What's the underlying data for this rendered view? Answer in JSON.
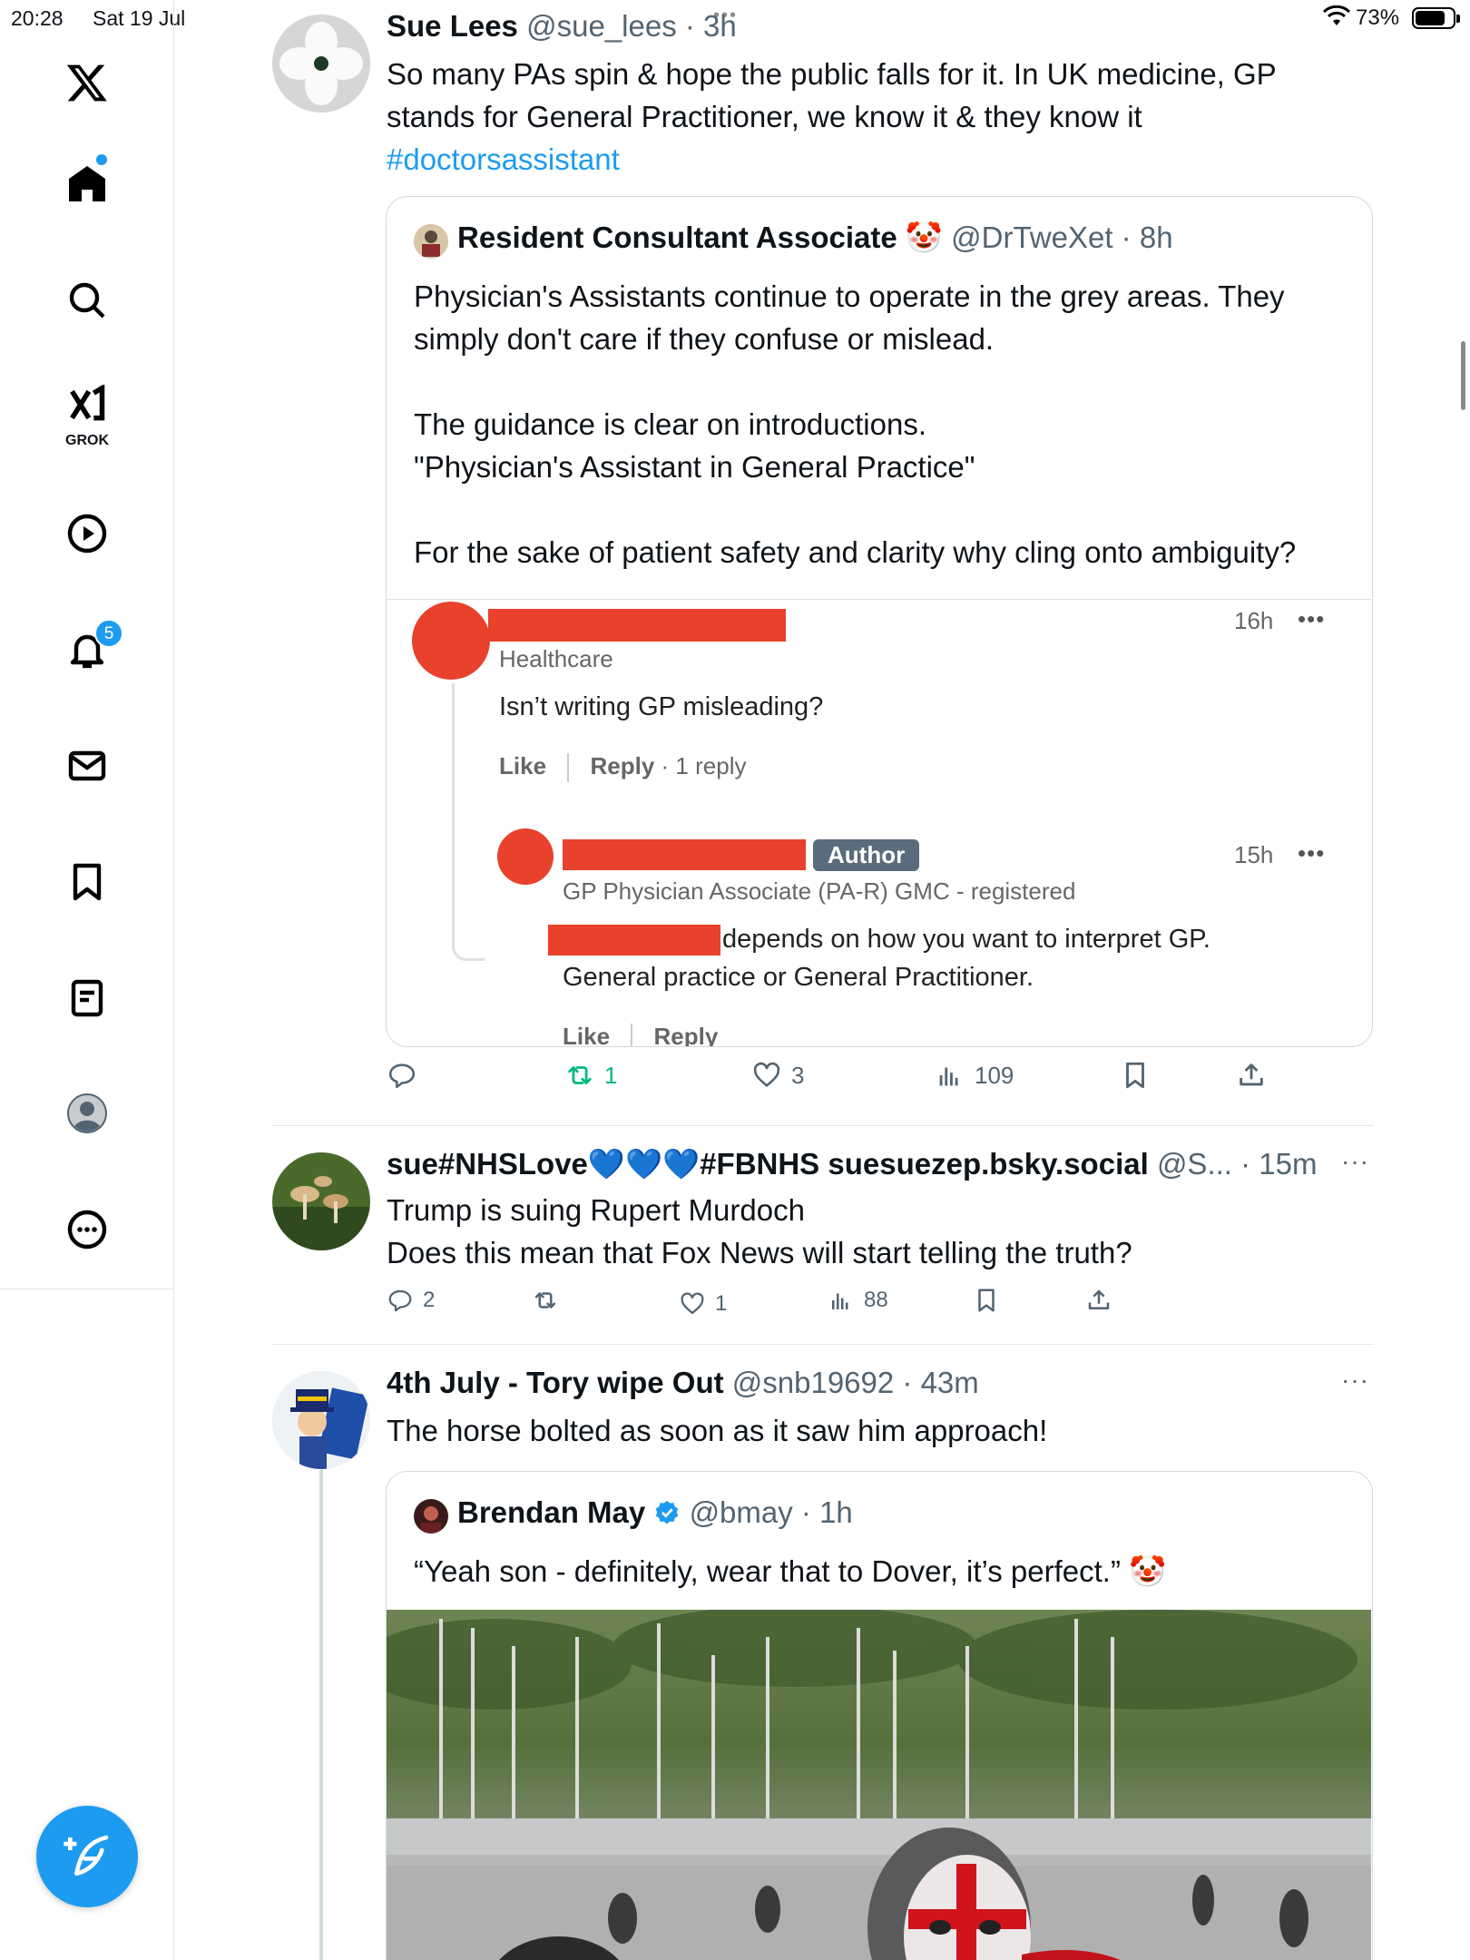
{
  "status_bar": {
    "time": "20:28",
    "date": "Sat 19 Jul",
    "battery": "73%"
  },
  "sidebar": {
    "grok_label": "GROK",
    "notifications_count": "5",
    "icons": [
      "x-logo-icon",
      "home-icon",
      "search-icon",
      "grok-icon",
      "video-icon",
      "bell-icon",
      "mail-icon",
      "bookmark-icon",
      "lists-icon",
      "profile-icon",
      "more-icon",
      "compose-icon"
    ]
  },
  "tweets": [
    {
      "name": "Sue Lees",
      "meta": "@sue_lees · 3h",
      "text_line1": "So many PAs spin & hope the public falls for it. In UK medicine, GP",
      "text_line2": "stands  for General Practitioner, we know it & they know it",
      "hashtag": "#doctorsassistant",
      "quote": {
        "name": "Resident Consultant Associate 🤡",
        "meta": "@DrTweXet · 8h",
        "lines": [
          "Physician's Assistants continue to operate in the grey areas. They",
          "simply don't care if they confuse or mislead.",
          "The guidance is clear on introductions.",
          "\"Physician's Assistant in General Practice\"",
          "For the sake of patient safety and clarity why cling onto ambiguity?"
        ],
        "embed": {
          "comment1": {
            "subtitle": "Healthcare",
            "time": "16h",
            "text": "Isn’t writing GP misleading?",
            "like": "Like",
            "reply": "Reply",
            "replies": "· 1 reply"
          },
          "comment2": {
            "tag": "Author",
            "subtitle": "GP Physician Associate (PA-R) GMC - registered",
            "time": "15h",
            "text1": "depends on how you want to interpret GP.",
            "text2": "General practice or General Practitioner.",
            "like": "Like",
            "reply": "Reply"
          }
        }
      },
      "stats": {
        "replies": "",
        "reposts": "1",
        "likes": "3",
        "views": "109"
      }
    },
    {
      "name": "sue#NHSLove💙💙💙#FBNHS suesuezep.bsky.social",
      "meta": "@S... · 15m",
      "text_line1": "Trump is suing Rupert Murdoch",
      "text_line2": "Does this mean that Fox News will start telling the truth?",
      "stats": {
        "replies": "2",
        "reposts": "",
        "likes": "1",
        "views": "88"
      }
    },
    {
      "name": "4th July - Tory wipe Out",
      "meta": "@snb19692 · 43m",
      "text_line1": "The horse bolted as soon as it saw him approach!",
      "quote": {
        "name": "Brendan May",
        "meta": "@bmay · 1h",
        "text": "“Yeah son - definitely, wear that to Dover, it’s perfect.” 🤡"
      }
    }
  ],
  "colors": {
    "accent": "#1d9bf0",
    "repost_green": "#00ba7c",
    "redaction": "#e8412c"
  }
}
